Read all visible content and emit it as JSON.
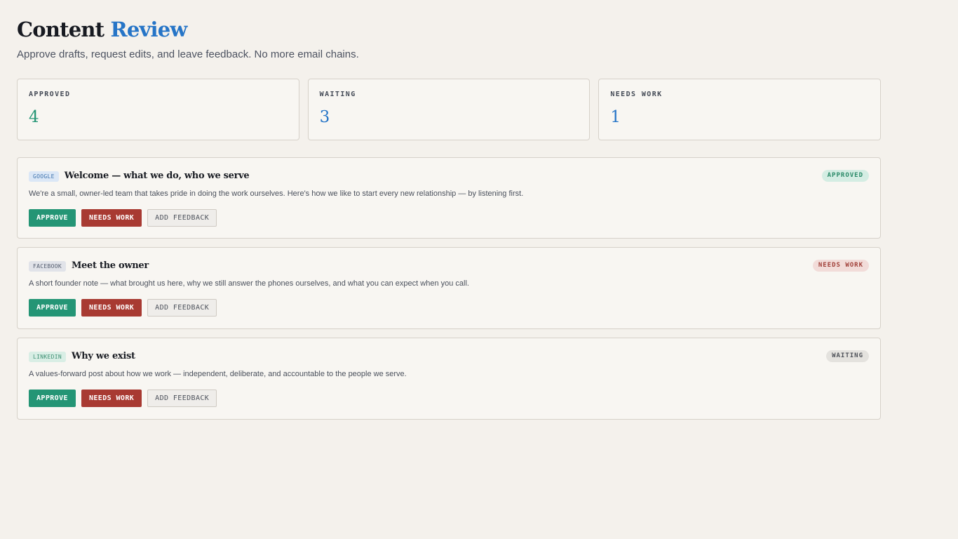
{
  "header": {
    "title_main": "Content",
    "title_accent": "Review",
    "subtitle": "Approve drafts, request edits, and leave feedback. No more email chains."
  },
  "stats": [
    {
      "label": "APPROVED",
      "value": "4"
    },
    {
      "label": "WAITING",
      "value": "3"
    },
    {
      "label": "NEEDS WORK",
      "value": "1"
    }
  ],
  "cards": [
    {
      "platform": "GOOGLE",
      "title": "Welcome — what we do, who we serve",
      "status": "APPROVED",
      "description": "We're a small, owner-led team that takes pride in doing the work ourselves. Here's how we like to start every new relationship — by listening first."
    },
    {
      "platform": "FACEBOOK",
      "title": "Meet the owner",
      "status": "NEEDS WORK",
      "description": "A short founder note — what brought us here, why we still answer the phones ourselves, and what you can expect when you call."
    },
    {
      "platform": "LINKEDIN",
      "title": "Why we exist",
      "status": "WAITING",
      "description": "A values-forward post about how we work — independent, deliberate, and accountable to the people we serve."
    }
  ],
  "actions": {
    "approve_label": "APPROVE",
    "needs_work_label": "NEEDS WORK",
    "feedback_label": "ADD FEEDBACK"
  },
  "colors": {
    "background": "#f4f1ec",
    "accent_blue": "#2675c7",
    "approve_green": "#249575",
    "needs_work_red": "#a83a32"
  }
}
